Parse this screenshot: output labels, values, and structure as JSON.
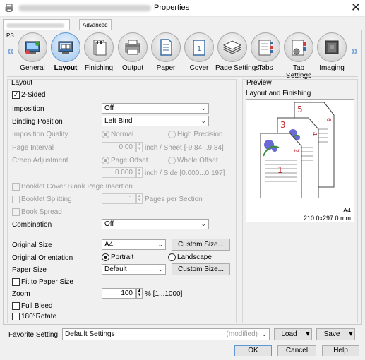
{
  "window": {
    "title": "Properties",
    "close_glyph": "✕"
  },
  "tabs": {
    "printer": "PS",
    "advanced": "Advanced"
  },
  "nav": {
    "left_arrow": "«",
    "right_arrow": "»",
    "items": [
      {
        "label": "General",
        "icon": "general-icon"
      },
      {
        "label": "Layout",
        "icon": "layout-icon",
        "active": true
      },
      {
        "label": "Finishing",
        "icon": "finishing-icon"
      },
      {
        "label": "Output",
        "icon": "output-icon"
      },
      {
        "label": "Paper",
        "icon": "paper-icon"
      },
      {
        "label": "Cover",
        "icon": "cover-icon"
      },
      {
        "label": "Page Settings",
        "icon": "page-settings-icon"
      },
      {
        "label": "Tabs",
        "icon": "tabs-icon"
      },
      {
        "label": "Tab\nSettings",
        "icon": "tab-settings-icon"
      },
      {
        "label": "Imaging",
        "icon": "imaging-icon"
      }
    ]
  },
  "layout": {
    "section": "Layout",
    "two_sided": {
      "label": "2-Sided",
      "checked": true
    },
    "imposition": {
      "label": "Imposition",
      "value": "Off"
    },
    "binding_position": {
      "label": "Binding Position",
      "value": "Left Bind"
    },
    "imposition_quality": {
      "label": "Imposition Quality",
      "normal": "Normal",
      "high": "High Precision"
    },
    "page_interval": {
      "label": "Page Interval",
      "value": "0.00",
      "unit": "inch / Sheet [-9.84...9.84]"
    },
    "creep_adjustment": {
      "label": "Creep Adjustment",
      "page_offset": "Page Offset",
      "whole_offset": "Whole Offset",
      "value": "0.000",
      "unit": "inch / Side [0.000...0.197]"
    },
    "booklet_cover": {
      "label": "Booklet Cover Blank Page Insertion"
    },
    "booklet_splitting": {
      "label": "Booklet Splitting",
      "value": "1",
      "unit": "Pages per Section"
    },
    "book_spread": {
      "label": "Book Spread"
    },
    "combination": {
      "label": "Combination",
      "value": "Off"
    },
    "original_size": {
      "label": "Original Size",
      "value": "A4",
      "button": "Custom Size..."
    },
    "original_orientation": {
      "label": "Original Orientation",
      "portrait": "Portrait",
      "landscape": "Landscape"
    },
    "paper_size": {
      "label": "Paper Size",
      "value": "Default",
      "button": "Custom Size..."
    },
    "fit_to_paper": {
      "label": "Fit to Paper Size"
    },
    "zoom": {
      "label": "Zoom",
      "value": "100",
      "unit": "% [1...1000]"
    },
    "full_bleed": {
      "label": "Full Bleed"
    },
    "rotate": {
      "label": "180°Rotate"
    }
  },
  "preview": {
    "section": "Preview",
    "title": "Layout and Finishing",
    "pages": [
      "5",
      "6",
      "3",
      "4",
      "1",
      "2"
    ],
    "paper": "A4",
    "dimensions": "210.0x297.0 mm"
  },
  "favorite": {
    "label": "Favorite Setting",
    "value": "Default Settings",
    "modified": "(modified)",
    "load": "Load",
    "save": "Save"
  },
  "buttons": {
    "ok": "OK",
    "cancel": "Cancel",
    "help": "Help"
  },
  "colors": {
    "accent": "#5e97d2",
    "page_number": "#c0282d"
  }
}
